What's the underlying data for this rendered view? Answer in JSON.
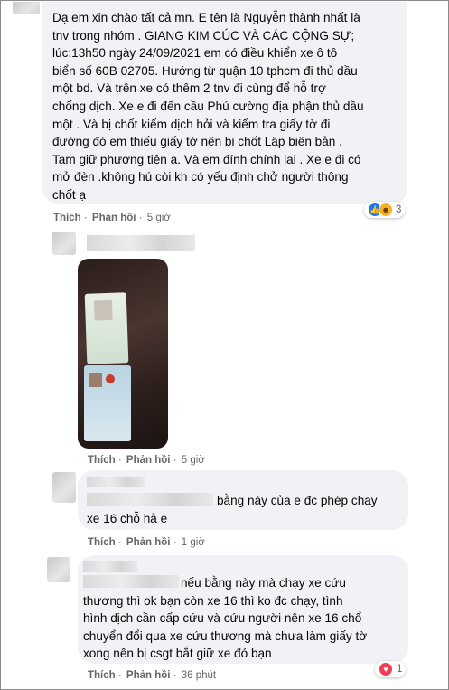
{
  "comments": [
    {
      "text": "Dạ em xin chào tất cả mn. E tên là Nguyễn thành nhất là\ntnv trong nhóm . GIANG KIM CÚC VÀ CÁC CỘNG SỰ;\nlúc:13h50 ngày 24/09/2021 em có điều khiển xe ô tô\nbiển số 60B 02705. Hướng từ quận 10 tphcm đi thủ dầu\nmột bd. Và trên xe có thêm 2 tnv đi cùng để hỗ trợ\nchống dịch. Xe e đi đến cầu Phú cường địa phận thủ dầu\nmột . Và bị chốt kiểm dịch hỏi và kiểm tra giấy tờ đi\nđường đó em thiếu giấy tờ nên bị chốt Lập biên bản .\nTam giữ phương tiện ạ. Và em đính chính lại . Xe e đi có\nmở đèn .không hú còi kh có yếu định chở người thông\nchốt ạ",
      "like": "Thích",
      "reply": "Phản hồi",
      "time": "5 giờ",
      "reaction_count": "3"
    },
    {
      "like": "Thích",
      "reply": "Phản hồi",
      "time": "5 giờ"
    },
    {
      "text": "bằng này của e đc phép chạy\nxe 16 chỗ hả e",
      "like": "Thích",
      "reply": "Phản hồi",
      "time": "1 giờ"
    },
    {
      "text": "nếu bằng này mà chạy xe cứu\nthương thì ok bạn còn xe 16 thì ko đc chạy, tình\nhình dịch cần cấp cứu và cứu người nên xe 16 chổ\nchuyển đổi qua xe cứu thương mà chưa làm giấy tờ\nxong nên bị csgt bắt giữ xe đó bạn",
      "like": "Thích",
      "reply": "Phản hồi",
      "time": "36 phút",
      "reaction_count": "1"
    }
  ],
  "separator": "·"
}
